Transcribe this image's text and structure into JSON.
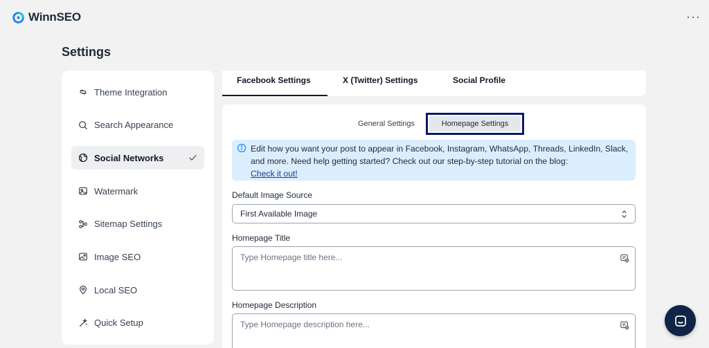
{
  "app": {
    "title": "WinnSEO",
    "more_label": "···"
  },
  "page": {
    "title": "Settings"
  },
  "sidebar": {
    "items": [
      {
        "label": "Theme Integration",
        "icon": "theme-integration-icon",
        "active": false
      },
      {
        "label": "Search Appearance",
        "icon": "search-icon",
        "active": false
      },
      {
        "label": "Social Networks",
        "icon": "globe-icon",
        "active": true
      },
      {
        "label": "Watermark",
        "icon": "image-watermark-icon",
        "active": false
      },
      {
        "label": "Sitemap Settings",
        "icon": "sitemap-icon",
        "active": false
      },
      {
        "label": "Image SEO",
        "icon": "image-icon",
        "active": false
      },
      {
        "label": "Local SEO",
        "icon": "location-pin-icon",
        "active": false
      },
      {
        "label": "Quick Setup",
        "icon": "magic-wand-icon",
        "active": false
      }
    ]
  },
  "tabs": [
    {
      "label": "Facebook Settings",
      "active": true
    },
    {
      "label": "X (Twitter) Settings",
      "active": false
    },
    {
      "label": "Social Profile",
      "active": false
    }
  ],
  "subtabs": {
    "general": "General Settings",
    "homepage": "Homepage Settings",
    "active": "homepage"
  },
  "info": {
    "text": "Edit how you want your post to appear in Facebook, Instagram, WhatsApp, Threads, LinkedIn, Slack, and more. Need help getting started? Check out our step-by-step tutorial on the blog:",
    "link": "Check it out!"
  },
  "form": {
    "image_source": {
      "label": "Default Image Source",
      "value": "First Available Image"
    },
    "homepage_title": {
      "label": "Homepage Title",
      "placeholder": "Type Homepage title here..."
    },
    "homepage_description": {
      "label": "Homepage Description",
      "placeholder": "Type Homepage description here..."
    }
  },
  "colors": {
    "accent": "#0b1a6b",
    "info_bg": "#dbeefe",
    "chat_button": "#0f2446",
    "logo_blue": "#1e88e5",
    "logo_teal": "#22c3d6"
  }
}
